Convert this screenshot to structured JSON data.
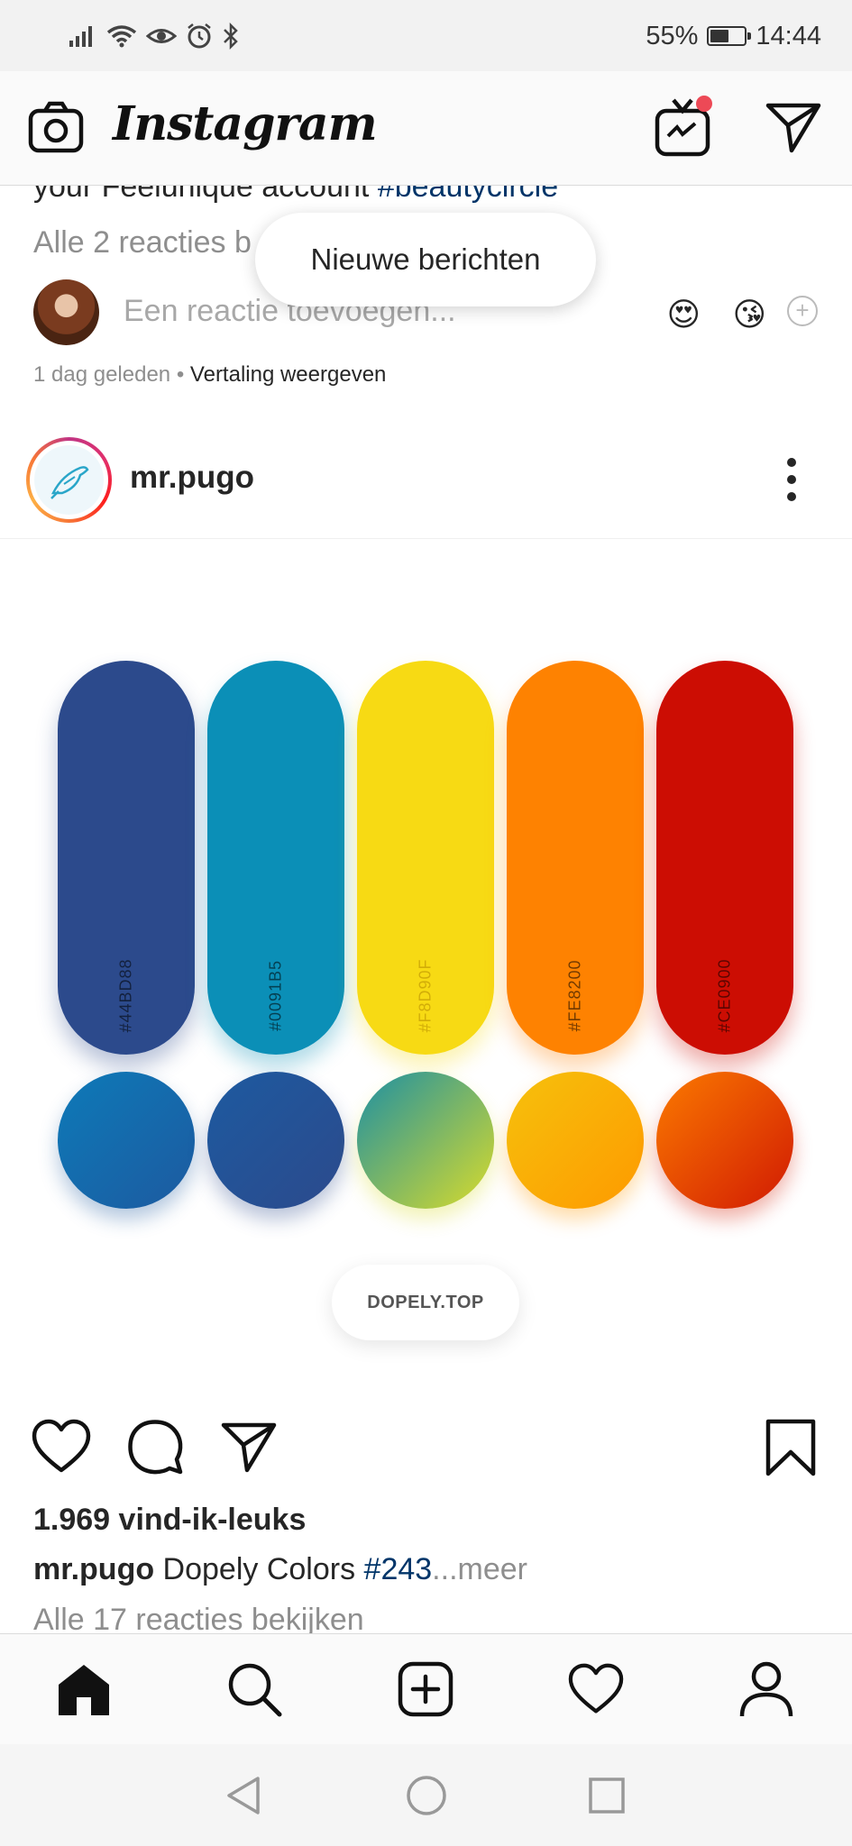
{
  "status_bar": {
    "battery_percent": "55%",
    "battery_level": 0.55,
    "time": "14:44",
    "icons": [
      "signal-icon",
      "wifi-icon",
      "eye-icon",
      "alarm-icon",
      "bluetooth-icon",
      "battery-icon"
    ]
  },
  "app_bar": {
    "logo": "Instagram",
    "left_icon": "camera-icon",
    "right_icons": [
      "igtv-icon",
      "direct-message-icon"
    ],
    "igtv_badge_color": "#ed4956"
  },
  "previous_post": {
    "caption_text": "your Feelunique account ",
    "caption_hashtag": "#beautycircle",
    "view_comments": "Alle 2 reacties b",
    "comment_placeholder": "Een reactie toevoegen...",
    "quick_emojis": [
      "😍",
      "😘"
    ],
    "timestamp": "1 dag geleden",
    "separator": " • ",
    "translate": "Vertaling weergeven"
  },
  "new_messages_pill": "Nieuwe berichten",
  "post": {
    "username": "mr.pugo",
    "image": {
      "swatches": [
        {
          "code": "#44BD88",
          "color": "#2c4a8c"
        },
        {
          "code": "#0091B5",
          "color": "#0b8fb7"
        },
        {
          "code": "#F8D90F",
          "color": "#f7da14"
        },
        {
          "code": "#FE8200",
          "color": "#fe8201"
        },
        {
          "code": "#CE0900",
          "color": "#cc0d03"
        }
      ],
      "gradients": [
        [
          "#0d7ab8",
          "#1d5aa0"
        ],
        [
          "#1d5aa0",
          "#2c4a8c"
        ],
        [
          "#1c8fa3",
          "#d9dc2b"
        ],
        [
          "#f6c10c",
          "#fe9a00"
        ],
        [
          "#fb7a00",
          "#d11a03"
        ]
      ],
      "source": "DOPELY.TOP"
    },
    "likes": "1.969 vind-ik-leuks",
    "caption_user": "mr.pugo",
    "caption_text": " Dopely Colors ",
    "caption_hashtag": "#243",
    "caption_more": "...meer",
    "view_all_comments": "Alle 17 reacties bekijken"
  },
  "bottom_nav": [
    "home-icon",
    "search-icon",
    "new-post-icon",
    "activity-icon",
    "profile-icon"
  ],
  "system_nav": [
    "back-icon",
    "home-circle-icon",
    "recents-icon"
  ]
}
